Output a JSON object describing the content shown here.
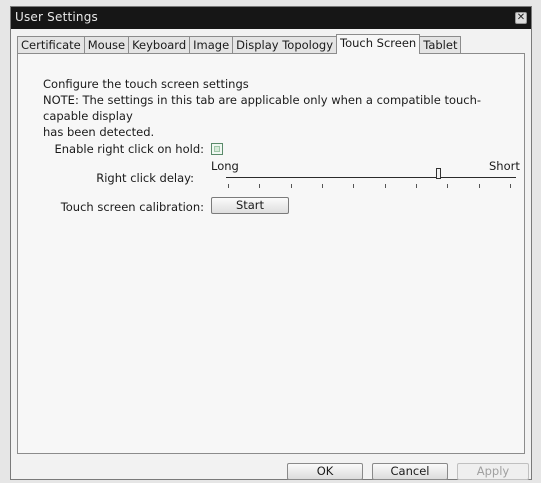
{
  "window": {
    "title": "User Settings"
  },
  "tabs": [
    {
      "label": "Certificate",
      "active": false
    },
    {
      "label": "Mouse",
      "active": false
    },
    {
      "label": "Keyboard",
      "active": false
    },
    {
      "label": "Image",
      "active": false
    },
    {
      "label": "Display Topology",
      "active": false
    },
    {
      "label": "Touch Screen",
      "active": true
    },
    {
      "label": "Tablet",
      "active": false
    }
  ],
  "content": {
    "intro_line1": "Configure the touch screen settings",
    "intro_line2": "NOTE: The settings in this tab are applicable only when a compatible touch-capable display",
    "intro_line3": "has been detected.",
    "right_click_hold_label": "Enable right click on hold:",
    "right_click_hold_checked": false,
    "right_click_delay_label": "Right click delay:",
    "slider": {
      "min_label": "Long",
      "max_label": "Short",
      "tick_count": 10,
      "value_fraction": 0.73
    },
    "calibration_label": "Touch screen calibration:",
    "start_label": "Start"
  },
  "footer": {
    "ok_label": "OK",
    "cancel_label": "Cancel",
    "apply_label": "Apply",
    "apply_enabled": false
  },
  "colors": {
    "titlebar": "#161616",
    "checkbox_border": "#5a8a6a"
  }
}
